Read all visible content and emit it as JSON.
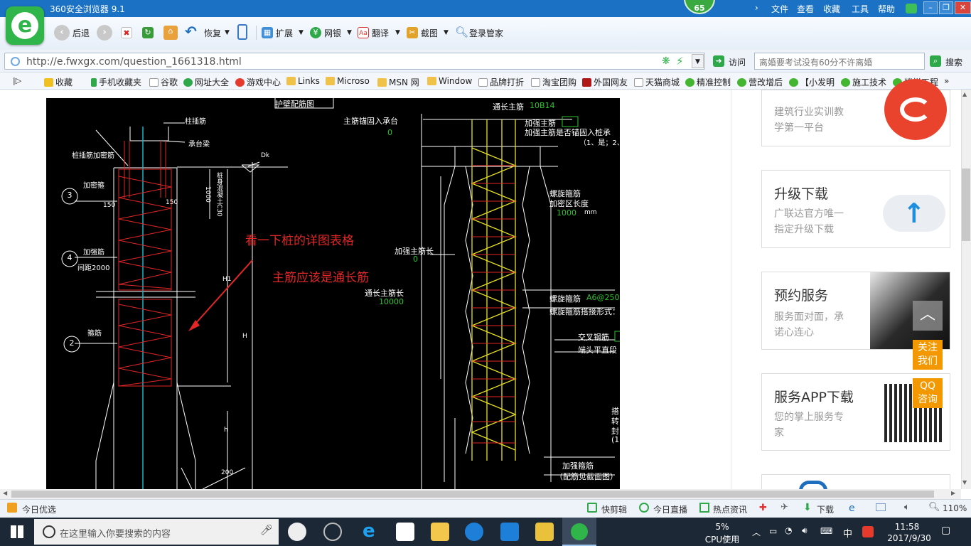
{
  "window": {
    "title": "360安全浏览器 9.1",
    "badge": "65",
    "menus": [
      "文件",
      "查看",
      "收藏",
      "工具",
      "帮助"
    ]
  },
  "toolbar": {
    "back": "后退",
    "restore": "恢复",
    "extend": "扩展",
    "netbank": "网银",
    "translate": "翻译",
    "screenshot": "截图",
    "login": "登录管家"
  },
  "address": {
    "url": "http://e.fwxgx.com/question_1661318.html",
    "visit": "访问",
    "search_placeholder": "离婚要考试没有60分不许离婚",
    "search_btn": "搜索"
  },
  "favorites": [
    "收藏",
    "手机收藏夹",
    "谷歌",
    "网址大全",
    "游戏中心",
    "Links",
    "Microso",
    "MSN 网",
    "Window",
    "品牌打折",
    "淘宝团购",
    "外国网友",
    "天猫商城",
    "精准控制",
    "营改增后",
    "【小发明",
    "施工技术",
    "楼梯工程"
  ],
  "drawing": {
    "annotation1": "看一下桩的详图表格",
    "annotation2": "主筋应该是通长筋",
    "left_labels": {
      "title": "护壁配筋图",
      "top1": "柱插筋",
      "top2": "桩插筋加密筋",
      "top3": "承台梁",
      "l3": "加密箍",
      "l3b": "150",
      "l3c": "150",
      "l4": "加强筋",
      "l4b": "间距2000",
      "l2": "箍筋",
      "vert1": "桩身混凝土C30",
      "n3": "3",
      "n4": "4",
      "n2": "2",
      "dk": "Dk",
      "h1": "H1",
      "h": "H",
      "h2": "h",
      "d200": "200",
      "d1000": "1000"
    },
    "right_labels": {
      "top_main": "通长主筋",
      "top_val": "10B14",
      "anchor": "主筋锚固入承台",
      "anchor_v": "0",
      "strong_main": "加强主筋",
      "strong_anchor": "加强主筋是否锚固入桩承",
      "strong_anchor2": "（1、是；2、",
      "spiral": "螺旋箍筋",
      "dense_len": "加密区长度",
      "dense_val": "1000",
      "mm": "mm",
      "strong_len": "加强主筋长",
      "strong_len_v": "0",
      "through_len": "通长主筋长",
      "through_len_v": "10000",
      "spiral2": "螺旋箍筋",
      "spiral2_v": "A6@250",
      "spiral_lap": "螺旋箍筋搭接形式：",
      "cross": "交叉钢筋",
      "end": "端头平直段",
      "strong_hoop": "加强箍筋",
      "strong_hoop2": "（配筋见截面图）",
      "c1": "搭",
      "c2": "转",
      "c3": "封",
      "c4": "(1"
    }
  },
  "sidebar": {
    "cards": [
      {
        "title": "",
        "sub1": "建筑行业实训教",
        "sub2": "学第一平台"
      },
      {
        "title": "升级下载",
        "sub1": "广联达官方唯一",
        "sub2": "指定升级下载"
      },
      {
        "title": "预约服务",
        "sub1": "服务面对面，承",
        "sub2": "诺心连心"
      },
      {
        "title": "服务APP下载",
        "sub1": "您的掌上服务专",
        "sub2": "家"
      }
    ],
    "follow": "关注我们",
    "qq": "QQ咨询"
  },
  "status": {
    "left": "今日优选",
    "items": [
      "快剪辑",
      "今日直播",
      "热点资讯"
    ],
    "download": "下载",
    "zoom": "110%"
  },
  "taskbar": {
    "search": "在这里输入你要搜索的内容",
    "cpu": "5%",
    "cpu_label": "CPU使用",
    "ime": "中",
    "time": "11:58",
    "date": "2017/9/30"
  }
}
